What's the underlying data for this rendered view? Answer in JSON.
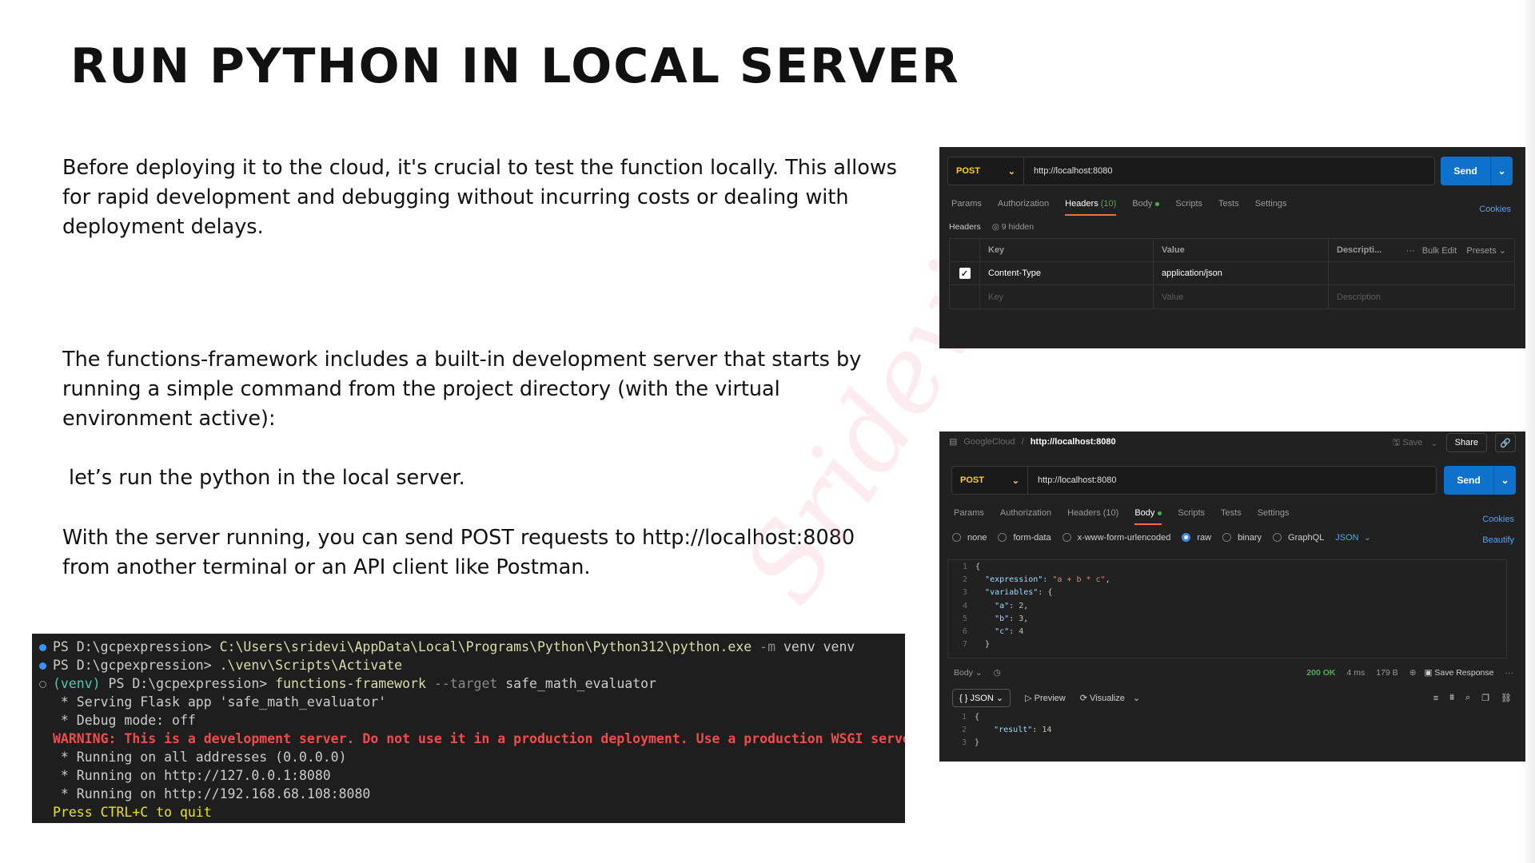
{
  "title": "RUN PYTHON IN LOCAL SERVER",
  "paragraphs": {
    "p1": "Before deploying it to the cloud, it's crucial to test the function locally. This allows for rapid development and debugging without incurring costs or dealing with deployment delays.",
    "p2": "The functions-framework includes a built-in development server that starts by running a simple command from the project directory (with the virtual environment active):",
    "p3": "let’s run the python in the local server.",
    "p4": "With the server running, you can send POST requests to http://localhost:8080 from another terminal or an API client like Postman."
  },
  "watermark": "Sridevi S",
  "terminal": {
    "l1_prompt": "PS D:\\gcpexpression> ",
    "l1_cmd": "C:\\Users\\sridevi\\AppData\\Local\\Programs\\Python\\Python312\\python.exe",
    "l1_flag": " -m",
    "l1_args": " venv venv",
    "l2_prompt": "PS D:\\gcpexpression> ",
    "l2_cmd": ".\\venv\\Scripts\\Activate",
    "l3_venv": "(venv)",
    "l3_prompt": " PS D:\\gcpexpression> ",
    "l3_cmd": "functions-framework",
    "l3_flag": " --target",
    "l3_args": " safe_math_evaluator",
    "l4": " * Serving Flask app 'safe_math_evaluator'",
    "l5": " * Debug mode: off",
    "l6": "WARNING: This is a development server. Do not use it in a production deployment. Use a production WSGI server instead.",
    "l7": " * Running on all addresses (0.0.0.0)",
    "l8": " * Running on http://127.0.0.1:8080",
    "l9": " * Running on http://192.168.68.108:8080",
    "l10": "Press CTRL+C to quit"
  },
  "postman1": {
    "method": "POST",
    "url": "http://localhost:8080",
    "send": "Send",
    "tabs": {
      "params": "Params",
      "authorization": "Authorization",
      "headers": "Headers",
      "headers_count": "(10)",
      "body": "Body",
      "scripts": "Scripts",
      "tests": "Tests",
      "settings": "Settings"
    },
    "cookies": "Cookies",
    "headers_label": "Headers",
    "hidden": "9 hidden",
    "columns": {
      "key": "Key",
      "value": "Value",
      "description": "Descripti...",
      "bulk_edit": "Bulk Edit",
      "presets": "Presets"
    },
    "row": {
      "key": "Content-Type",
      "value": "application/json"
    },
    "placeholders": {
      "key": "Key",
      "value": "Value",
      "description": "Description"
    }
  },
  "postman2": {
    "breadcrumb_parent": "GoogleCloud",
    "breadcrumb_sep": "/",
    "breadcrumb_current": "http://localhost:8080",
    "save": "Save",
    "share": "Share",
    "method": "POST",
    "url": "http://localhost:8080",
    "send": "Send",
    "tabs": {
      "params": "Params",
      "authorization": "Authorization",
      "headers": "Headers (10)",
      "body": "Body",
      "scripts": "Scripts",
      "tests": "Tests",
      "settings": "Settings"
    },
    "cookies": "Cookies",
    "beautify": "Beautify",
    "body_types": {
      "none": "none",
      "form_data": "form-data",
      "urlencoded": "x-www-form-urlencoded",
      "raw": "raw",
      "binary": "binary",
      "graphql": "GraphQL",
      "json": "JSON"
    },
    "request_body": [
      {
        "ln": "1",
        "text": "{"
      },
      {
        "ln": "2",
        "key": "\"expression\"",
        "val": "\"a + b * c\"",
        "end": ","
      },
      {
        "ln": "3",
        "key": "\"variables\"",
        "val": "{",
        "end": ""
      },
      {
        "ln": "4",
        "key": "\"a\"",
        "val": "2",
        "end": ","
      },
      {
        "ln": "5",
        "key": "\"b\"",
        "val": "3",
        "end": ","
      },
      {
        "ln": "6",
        "key": "\"c\"",
        "val": "4",
        "end": ""
      },
      {
        "ln": "7",
        "text": "}"
      }
    ],
    "response": {
      "body_label": "Body",
      "status": "200 OK",
      "time": "4 ms",
      "size": "179 B",
      "save_response": "Save Response",
      "format": "{ } JSON",
      "preview": "Preview",
      "visualize": "Visualize",
      "lines": [
        {
          "ln": "1",
          "text": "{"
        },
        {
          "ln": "2",
          "key": "\"result\"",
          "val": "14"
        },
        {
          "ln": "3",
          "text": "}"
        }
      ]
    }
  },
  "colors": {
    "accent": "#0e72cc",
    "method": "#ffcc33",
    "ok": "#4caf50"
  }
}
